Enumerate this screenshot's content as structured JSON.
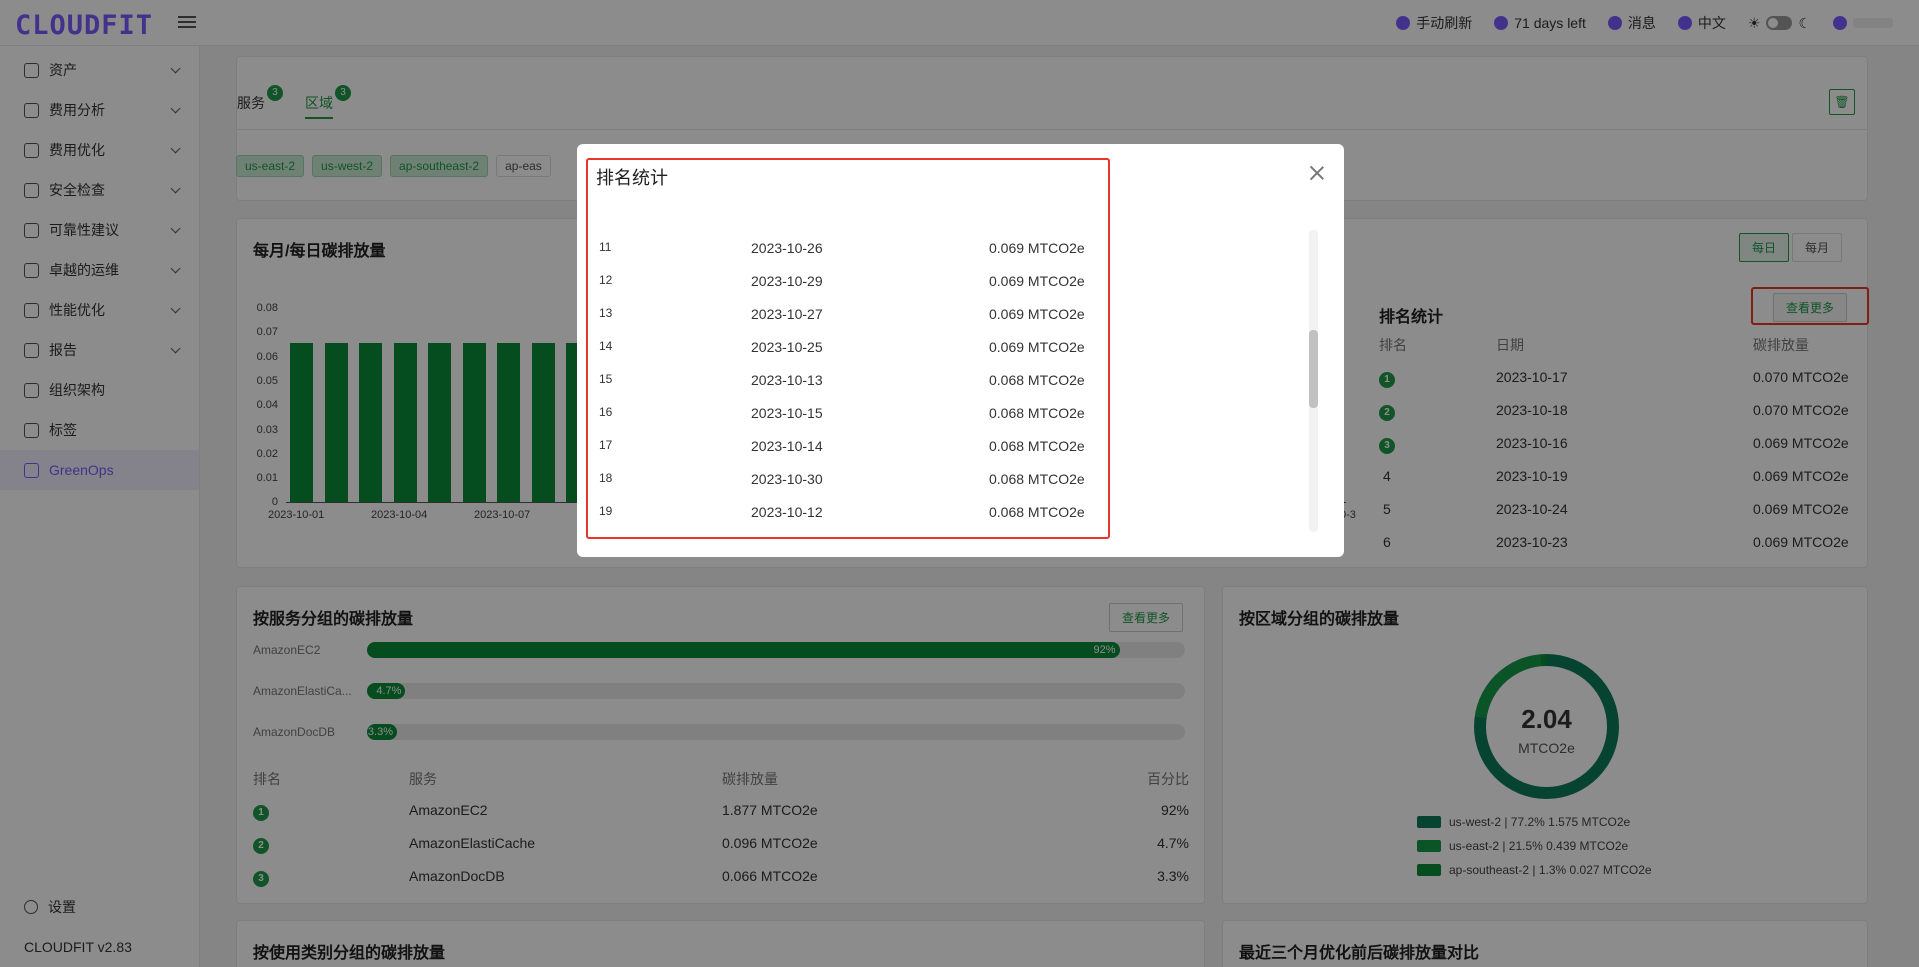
{
  "app": {
    "logo": "CLOUDFIT"
  },
  "topbar": {
    "refresh": "手动刷新",
    "days_left": "71 days left",
    "messages": "消息",
    "language": "中文"
  },
  "sidebar": {
    "items": [
      {
        "label": "资产"
      },
      {
        "label": "费用分析"
      },
      {
        "label": "费用优化"
      },
      {
        "label": "安全检查"
      },
      {
        "label": "可靠性建议"
      },
      {
        "label": "卓越的运维"
      },
      {
        "label": "性能优化"
      },
      {
        "label": "报告"
      },
      {
        "label": "组织架构"
      },
      {
        "label": "标签"
      },
      {
        "label": "GreenOps"
      }
    ],
    "settings": "设置",
    "version": "CLOUDFIT v2.83"
  },
  "filters": {
    "tab_service": "服务",
    "tab_service_count": "3",
    "tab_region": "区域",
    "tab_region_count": "3",
    "chips": [
      "us-east-2",
      "us-west-2",
      "ap-southeast-2",
      "ap-eas"
    ]
  },
  "daily_chart": {
    "title": "每月/每日碳排放量",
    "btn_daily": "每日",
    "btn_monthly": "每月",
    "y_ticks": [
      "0.08",
      "0.07",
      "0.06",
      "0.05",
      "0.04",
      "0.03",
      "0.02",
      "0.01",
      "0"
    ],
    "x_ticks": [
      "2023-10-01",
      "2023-10-04",
      "2023-10-07"
    ],
    "x_tail": "0-3"
  },
  "chart_data": {
    "type": "bar",
    "categories": [
      "2023-10-01",
      "2023-10-02",
      "2023-10-03",
      "2023-10-04",
      "2023-10-05",
      "2023-10-06",
      "2023-10-07",
      "2023-10-08",
      "2023-10-09"
    ],
    "values": [
      0.066,
      0.066,
      0.066,
      0.066,
      0.066,
      0.066,
      0.066,
      0.066,
      0.066
    ],
    "ylim": [
      0,
      0.08
    ]
  },
  "rank_panel": {
    "title": "排名统计",
    "more": "查看更多",
    "headers": {
      "rank": "排名",
      "date": "日期",
      "amount": "碳排放量"
    },
    "rows": [
      {
        "rank": "1",
        "date": "2023-10-17",
        "amount": "0.070 MTCO2e"
      },
      {
        "rank": "2",
        "date": "2023-10-18",
        "amount": "0.070 MTCO2e"
      },
      {
        "rank": "3",
        "date": "2023-10-16",
        "amount": "0.069 MTCO2e"
      },
      {
        "rank": "4",
        "date": "2023-10-19",
        "amount": "0.069 MTCO2e"
      },
      {
        "rank": "5",
        "date": "2023-10-24",
        "amount": "0.069 MTCO2e"
      },
      {
        "rank": "6",
        "date": "2023-10-23",
        "amount": "0.069 MTCO2e"
      }
    ]
  },
  "service_card": {
    "title": "按服务分组的碳排放量",
    "more": "查看更多",
    "bars": [
      {
        "name": "AmazonEC2",
        "pct_label": "92%",
        "pct": 92
      },
      {
        "name": "AmazonElastiCa...",
        "pct_label": "4.7%",
        "pct": 4.7
      },
      {
        "name": "AmazonDocDB",
        "pct_label": "3.3%",
        "pct": 3.3
      }
    ],
    "headers": {
      "rank": "排名",
      "service": "服务",
      "amount": "碳排放量",
      "pct": "百分比"
    },
    "rows": [
      {
        "rank": "1",
        "service": "AmazonEC2",
        "amount": "1.877 MTCO2e",
        "pct": "92%"
      },
      {
        "rank": "2",
        "service": "AmazonElastiCache",
        "amount": "0.096 MTCO2e",
        "pct": "4.7%"
      },
      {
        "rank": "3",
        "service": "AmazonDocDB",
        "amount": "0.066 MTCO2e",
        "pct": "3.3%"
      }
    ]
  },
  "region_card": {
    "title": "按区域分组的碳排放量",
    "total": "2.04",
    "unit": "MTCO2e",
    "legend": [
      {
        "label": "us-west-2 | 77.2% 1.575 MTCO2e",
        "color": "#0c7a5a"
      },
      {
        "label": "us-east-2 | 21.5% 0.439 MTCO2e",
        "color": "#139a4a"
      },
      {
        "label": "ap-southeast-2 | 1.3% 0.027 MTCO2e",
        "color": "#0a8a3a"
      }
    ]
  },
  "bottom": {
    "left_title": "按使用类别分组的碳排放量",
    "right_title": "最近三个月优化前后碳排放量对比"
  },
  "modal": {
    "title": "排名统计",
    "rows": [
      {
        "rank": "11",
        "date": "2023-10-26",
        "amount": "0.069 MTCO2e"
      },
      {
        "rank": "12",
        "date": "2023-10-29",
        "amount": "0.069 MTCO2e"
      },
      {
        "rank": "13",
        "date": "2023-10-27",
        "amount": "0.069 MTCO2e"
      },
      {
        "rank": "14",
        "date": "2023-10-25",
        "amount": "0.069 MTCO2e"
      },
      {
        "rank": "15",
        "date": "2023-10-13",
        "amount": "0.068 MTCO2e"
      },
      {
        "rank": "16",
        "date": "2023-10-15",
        "amount": "0.068 MTCO2e"
      },
      {
        "rank": "17",
        "date": "2023-10-14",
        "amount": "0.068 MTCO2e"
      },
      {
        "rank": "18",
        "date": "2023-10-30",
        "amount": "0.068 MTCO2e"
      },
      {
        "rank": "19",
        "date": "2023-10-12",
        "amount": "0.068 MTCO2e"
      }
    ]
  }
}
